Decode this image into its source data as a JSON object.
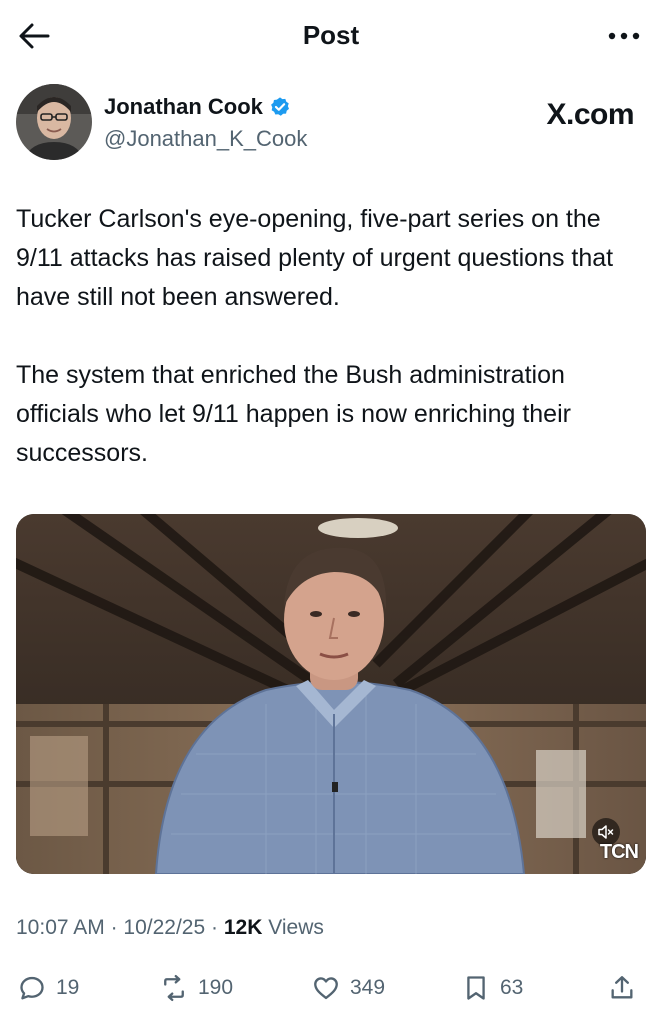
{
  "header": {
    "title": "Post",
    "back_icon": "arrow-left-icon",
    "more_icon": "more-horizontal-icon"
  },
  "author": {
    "display_name": "Jonathan Cook",
    "handle": "@Jonathan_K_Cook",
    "verified_color": "#1d9bf0"
  },
  "watermark": {
    "text": "X.com"
  },
  "post": {
    "paragraphs": [
      "Tucker Carlson's eye-opening, five-part series on the 9/11 attacks has raised plenty of urgent questions that have still not been answered.",
      "The system that enriched the Bush administration officials who let 9/11 happen is now enriching their successors."
    ]
  },
  "media": {
    "logo_text": "TCN"
  },
  "meta": {
    "time": "10:07 AM",
    "separator": "·",
    "date": "10/22/25",
    "views_count": "12K",
    "views_label": "Views"
  },
  "actions": {
    "replies": "19",
    "reposts": "190",
    "likes": "349",
    "bookmarks": "63"
  },
  "colors": {
    "text": "#0f1419",
    "secondary": "#536471",
    "accent": "#1d9bf0"
  }
}
